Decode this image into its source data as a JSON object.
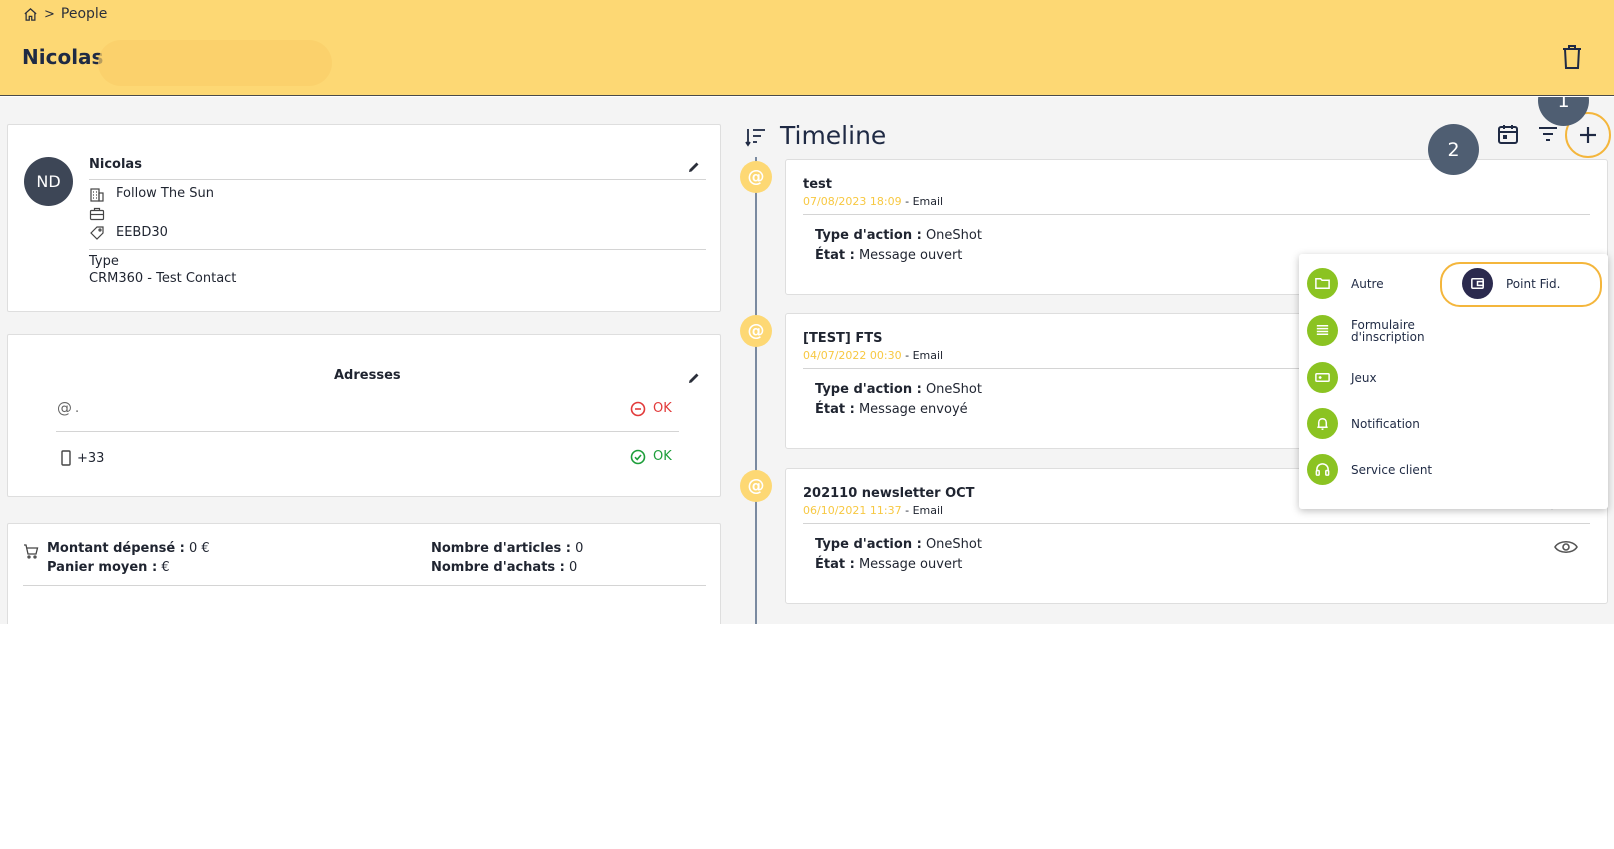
{
  "breadcrumb": {
    "items": [
      "People"
    ]
  },
  "header": {
    "title": "Nicolas"
  },
  "contact": {
    "initials": "ND",
    "name": "Nicolas",
    "company": "Follow The Sun",
    "tag": "EEBD30",
    "type_label": "Type",
    "type_value": "CRM360 - Test Contact"
  },
  "addresses": {
    "title": "Adresses",
    "rows": [
      {
        "value": ".",
        "status": "OK"
      },
      {
        "value": "+33",
        "status": "OK"
      }
    ]
  },
  "stats": {
    "spent_label": "Montant dépensé :",
    "spent_value": "0 €",
    "basket_label": "Panier moyen :",
    "basket_value": "€",
    "articles_label": "Nombre d'articles :",
    "articles_value": "0",
    "purchases_label": "Nombre d'achats :",
    "purchases_value": "0"
  },
  "timeline": {
    "title": "Timeline",
    "action_label": "Type d'action :",
    "state_label": "État :",
    "items": [
      {
        "title": "test",
        "date": "07/08/2023 18:09",
        "channel": " - Email",
        "action": "OneShot",
        "state": "Message ouvert"
      },
      {
        "title": "[TEST] FTS",
        "date": "04/07/2022 00:30",
        "channel": " - Email",
        "action": "OneShot",
        "state": "Message envoyé"
      },
      {
        "title": "202110 newsletter OCT",
        "date": "06/10/2021 11:37",
        "channel": " - Email",
        "action": "OneShot",
        "state": "Message ouvert"
      }
    ]
  },
  "add_menu": {
    "items": [
      "Autre",
      "Formulaire d'inscription",
      "Jeux",
      "Notification",
      "Service client",
      "Point Fid."
    ]
  },
  "annotations": {
    "badge1": "1",
    "badge2": "2"
  },
  "colors": {
    "header_bg": "#fdd874",
    "accent": "#f4b63c",
    "menu_icon": "#8bc322",
    "avatar": "#3d4656"
  }
}
